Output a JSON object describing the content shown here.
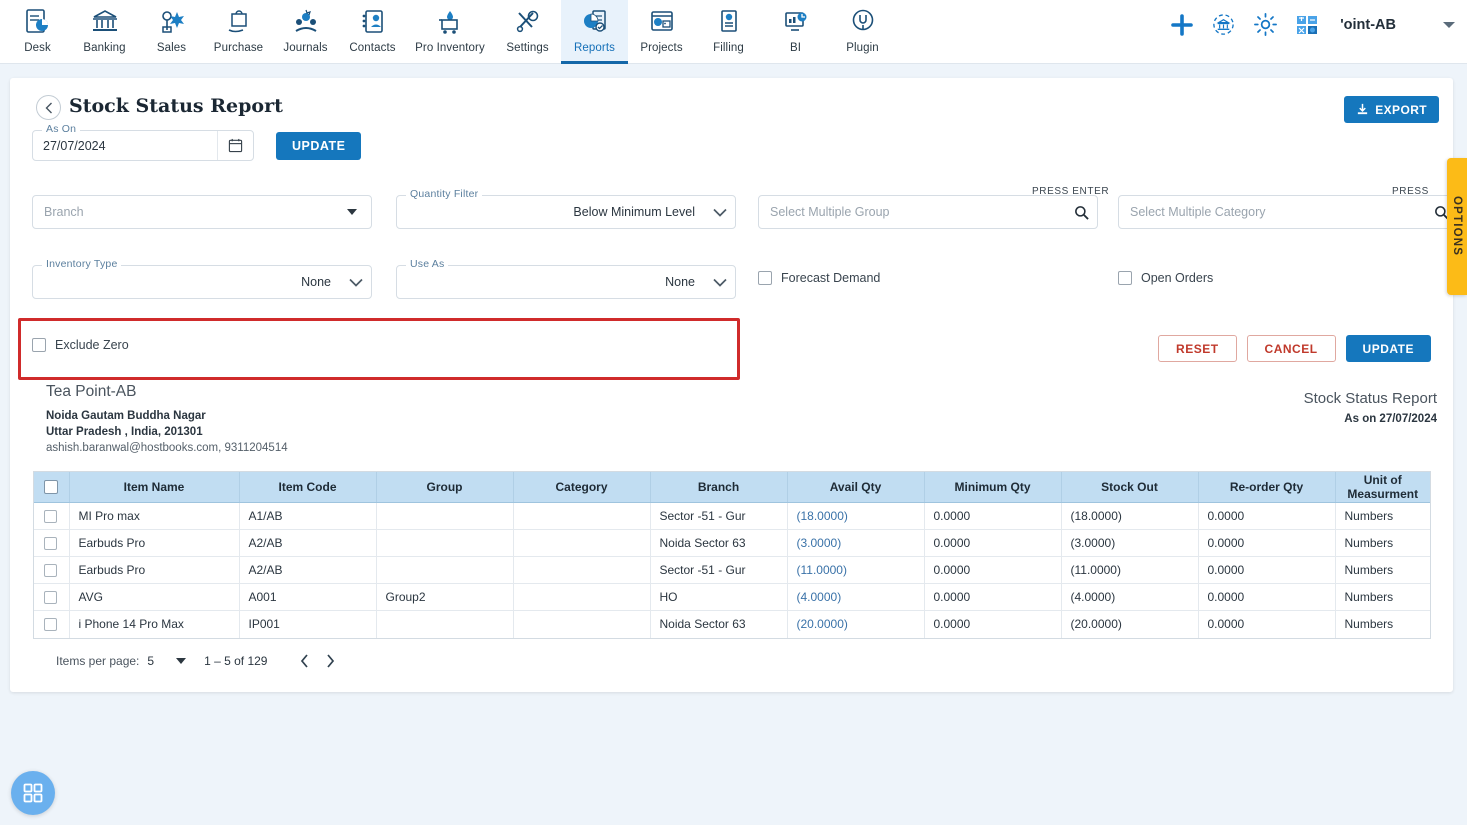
{
  "nav": {
    "items": [
      {
        "label": "Desk",
        "icon": "desk-icon"
      },
      {
        "label": "Banking",
        "icon": "bank-icon"
      },
      {
        "label": "Sales",
        "icon": "sales-icon"
      },
      {
        "label": "Purchase",
        "icon": "purchase-icon"
      },
      {
        "label": "Journals",
        "icon": "journals-icon"
      },
      {
        "label": "Contacts",
        "icon": "contacts-icon"
      },
      {
        "label": "Pro Inventory",
        "icon": "inventory-icon"
      },
      {
        "label": "Settings",
        "icon": "settings-icon"
      },
      {
        "label": "Reports",
        "icon": "reports-icon"
      },
      {
        "label": "Projects",
        "icon": "projects-icon"
      },
      {
        "label": "Filling",
        "icon": "filling-icon"
      },
      {
        "label": "BI",
        "icon": "bi-icon"
      },
      {
        "label": "Plugin",
        "icon": "plugin-icon"
      }
    ],
    "active": "Reports",
    "right": {
      "add_icon": "plus-icon",
      "bank_sync_icon": "bank-refresh-icon",
      "settings_icon": "gear-icon",
      "calculator_icon": "calculator-icon",
      "company": "'oint-AB",
      "chevron_icon": "chevron-down-icon"
    }
  },
  "page": {
    "back_icon": "chevron-left-icon",
    "title": "Stock Status Report",
    "export_label": "EXPORT",
    "export_icon": "download-icon"
  },
  "ason": {
    "label": "As On",
    "value": "27/07/2024",
    "calendar_icon": "calendar-icon",
    "update_label": "UPDATE"
  },
  "filters": {
    "branch": {
      "placeholder": "Branch",
      "value": "",
      "dropdown_icon": "triangle-down-icon"
    },
    "quantity_filter": {
      "label": "Quantity Filter",
      "value": "Below Minimum Level",
      "dropdown_icon": "chevron-down-icon"
    },
    "group": {
      "hint": "PRESS ENTER",
      "placeholder": "Select Multiple Group",
      "search_icon": "search-icon"
    },
    "category": {
      "hint": "PRESS ENTER",
      "placeholder": "Select Multiple Category",
      "search_icon": "search-icon"
    },
    "inventory_type": {
      "label": "Inventory Type",
      "value": "None",
      "dropdown_icon": "chevron-down-icon"
    },
    "use_as": {
      "label": "Use As",
      "value": "None",
      "dropdown_icon": "chevron-down-icon"
    },
    "forecast_demand": {
      "label": "Forecast Demand",
      "checked": false
    },
    "open_orders": {
      "label": "Open Orders",
      "checked": false
    },
    "exclude_zero": {
      "label": "Exclude Zero",
      "checked": false
    }
  },
  "actions": {
    "reset_label": "RESET",
    "cancel_label": "CANCEL",
    "update_label": "UPDATE"
  },
  "company": {
    "name": "Tea Point-AB",
    "address_line1": "Noida Gautam Buddha Nagar",
    "address_line2": "Uttar Pradesh , India, 201301",
    "contact": "ashish.baranwal@hostbooks.com, 9311204514"
  },
  "report_header": {
    "title": "Stock Status Report",
    "as_on": "As on 27/07/2024"
  },
  "table": {
    "columns": [
      "Item Name",
      "Item Code",
      "Group",
      "Category",
      "Branch",
      "Avail Qty",
      "Minimum Qty",
      "Stock Out",
      "Re-order Qty",
      "Unit of Measurment"
    ],
    "rows": [
      {
        "item_name": "MI Pro max",
        "item_code": "A1/AB",
        "group": "",
        "category": "",
        "branch": "Sector -51 - Gur",
        "avail_qty": "(18.0000)",
        "minimum_qty": "0.0000",
        "stock_out": "(18.0000)",
        "reorder_qty": "0.0000",
        "uom": "Numbers"
      },
      {
        "item_name": "Earbuds Pro",
        "item_code": "A2/AB",
        "group": "",
        "category": "",
        "branch": "Noida Sector 63",
        "avail_qty": "(3.0000)",
        "minimum_qty": "0.0000",
        "stock_out": "(3.0000)",
        "reorder_qty": "0.0000",
        "uom": "Numbers"
      },
      {
        "item_name": "Earbuds Pro",
        "item_code": "A2/AB",
        "group": "",
        "category": "",
        "branch": "Sector -51 - Gur",
        "avail_qty": "(11.0000)",
        "minimum_qty": "0.0000",
        "stock_out": "(11.0000)",
        "reorder_qty": "0.0000",
        "uom": "Numbers"
      },
      {
        "item_name": "AVG",
        "item_code": "A001",
        "group": "Group2",
        "category": "",
        "branch": "HO",
        "avail_qty": "(4.0000)",
        "minimum_qty": "0.0000",
        "stock_out": "(4.0000)",
        "reorder_qty": "0.0000",
        "uom": "Numbers"
      },
      {
        "item_name": "i Phone 14 Pro Max",
        "item_code": "IP001",
        "group": "",
        "category": "",
        "branch": "Noida Sector 63",
        "avail_qty": "(20.0000)",
        "minimum_qty": "0.0000",
        "stock_out": "(20.0000)",
        "reorder_qty": "0.0000",
        "uom": "Numbers"
      }
    ]
  },
  "paginator": {
    "items_per_page_label": "Items per page:",
    "items_per_page_value": "5",
    "range": "1 – 5 of 129",
    "prev_icon": "chevron-left-icon",
    "next_icon": "chevron-right-icon"
  },
  "options_tab": {
    "label": "OPTIONS"
  },
  "fab": {
    "icon": "apps-grid-icon"
  },
  "colors": {
    "primary_blue": "#1577bd",
    "nav_active_bg": "#e8f2fb",
    "table_header_bg": "#c1ddf2",
    "highlight_red": "#d02b2b",
    "options_amber": "#fcbb17",
    "link_blue": "#3a72a8",
    "page_bg": "#eef4fa"
  }
}
